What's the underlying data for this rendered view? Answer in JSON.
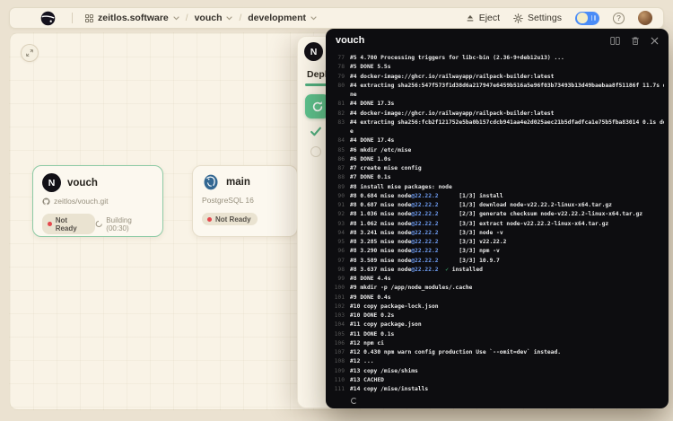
{
  "navbar": {
    "breadcrumb": {
      "workspace": "zeitlos.software",
      "project": "vouch",
      "environment": "development"
    },
    "eject_label": "Eject",
    "settings_label": "Settings",
    "help_icon": "?",
    "theme_toggle_on": true,
    "accent_toggle_color": "#4a8cf7",
    "icons": [
      "railway-logo",
      "workspace-icon",
      "chevron-down-icon",
      "eject-icon",
      "gear-icon",
      "help-icon",
      "avatar"
    ]
  },
  "canvas": {
    "cards": {
      "vouch": {
        "logo_letter": "N",
        "title": "vouch",
        "repo": "zeitlos/vouch.git",
        "status": "Not Ready",
        "status_dot_color": "#e5484d",
        "building": "Building (00:30)"
      },
      "main": {
        "title": "main",
        "subtitle": "PostgreSQL 16",
        "status": "Not Ready",
        "status_dot_color": "#e5484d"
      }
    }
  },
  "drawer": {
    "logo_letter": "N",
    "tab": "Deployments",
    "tab_accent": "#4fae7f",
    "icons": [
      "rotate-icon",
      "check-icon"
    ]
  },
  "log_panel": {
    "title": "vouch",
    "background": "#0d0d10",
    "icons": [
      "split-view-icon",
      "trash-icon",
      "close-icon"
    ],
    "lines": [
      {
        "n": "77",
        "s": [
          [
            "#5 4.700 Processing triggers for libc-bin (2.36-9+deb12u13) ...",
            "w"
          ]
        ]
      },
      {
        "n": "78",
        "s": [
          [
            "#5 DONE 5.5s",
            "w"
          ]
        ]
      },
      {
        "n": "79",
        "s": [
          [
            "#4 docker-image://ghcr.io/railwayapp/railpack-builder:latest",
            "w"
          ]
        ]
      },
      {
        "n": "80",
        "s": [
          [
            "#4 extracting sha256:547f573f1d38d6a217947e6459b516a5e96f03b73493b13d49baebaa8f51186f 11.7s do",
            "w"
          ]
        ]
      },
      {
        "n": "",
        "s": [
          [
            "ne",
            "w"
          ]
        ]
      },
      {
        "n": "81",
        "s": [
          [
            "#4 DONE 17.3s",
            "w"
          ]
        ]
      },
      {
        "n": "82",
        "s": [
          [
            "#4 docker-image://ghcr.io/railwayapp/railpack-builder:latest",
            "w"
          ]
        ]
      },
      {
        "n": "83",
        "s": [
          [
            "#4 extracting sha256:fcb2f121752e5ba0b157cdcb941aa4e2d025aec21b5dfadfca1e75b5fba83014 0.1s don",
            "w"
          ]
        ]
      },
      {
        "n": "",
        "s": [
          [
            "e",
            "w"
          ]
        ]
      },
      {
        "n": "84",
        "s": [
          [
            "#4 DONE 17.4s",
            "w"
          ]
        ]
      },
      {
        "n": "85",
        "s": [
          [
            "#6 mkdir /etc/mise",
            "w"
          ]
        ]
      },
      {
        "n": "86",
        "s": [
          [
            "#6 DONE 1.0s",
            "w"
          ]
        ]
      },
      {
        "n": "87",
        "s": [
          [
            "#7 create mise config",
            "w"
          ]
        ]
      },
      {
        "n": "88",
        "s": [
          [
            "#7 DONE 0.1s",
            "w"
          ]
        ]
      },
      {
        "n": "89",
        "s": [
          [
            "#8 install mise packages: node",
            "w"
          ]
        ]
      },
      {
        "n": "90",
        "s": [
          [
            "#8 0.684 mise node",
            "w"
          ],
          [
            "@22.22.2",
            "b"
          ],
          [
            "      [1/3] install",
            "w"
          ]
        ]
      },
      {
        "n": "91",
        "s": [
          [
            "#8 0.687 mise node",
            "w"
          ],
          [
            "@22.22.2",
            "b"
          ],
          [
            "      [1/3] download node-v22.22.2-linux-x64.tar.gz",
            "w"
          ]
        ]
      },
      {
        "n": "92",
        "s": [
          [
            "#8 1.036 mise node",
            "w"
          ],
          [
            "@22.22.2",
            "b"
          ],
          [
            "      [2/3] generate checksum node-v22.22.2-linux-x64.tar.gz",
            "w"
          ]
        ]
      },
      {
        "n": "93",
        "s": [
          [
            "#8 1.062 mise node",
            "w"
          ],
          [
            "@22.22.2",
            "b"
          ],
          [
            "      [3/3] extract node-v22.22.2-linux-x64.tar.gz",
            "w"
          ]
        ]
      },
      {
        "n": "94",
        "s": [
          [
            "#8 3.241 mise node",
            "w"
          ],
          [
            "@22.22.2",
            "b"
          ],
          [
            "      [3/3] node -v",
            "w"
          ]
        ]
      },
      {
        "n": "95",
        "s": [
          [
            "#8 3.285 mise node",
            "w"
          ],
          [
            "@22.22.2",
            "b"
          ],
          [
            "      [3/3] v22.22.2",
            "w"
          ]
        ]
      },
      {
        "n": "96",
        "s": [
          [
            "#8 3.290 mise node",
            "w"
          ],
          [
            "@22.22.2",
            "b"
          ],
          [
            "      [3/3] npm -v",
            "w"
          ]
        ]
      },
      {
        "n": "97",
        "s": [
          [
            "#8 3.589 mise node",
            "w"
          ],
          [
            "@22.22.2",
            "b"
          ],
          [
            "      [3/3] 10.9.7",
            "w"
          ]
        ]
      },
      {
        "n": "98",
        "s": [
          [
            "#8 3.637 mise node",
            "w"
          ],
          [
            "@22.22.2",
            "b"
          ],
          [
            "  ",
            "w"
          ],
          [
            "✓",
            "g"
          ],
          [
            " installed",
            "w"
          ]
        ]
      },
      {
        "n": "99",
        "s": [
          [
            "#8 DONE 4.4s",
            "w"
          ]
        ]
      },
      {
        "n": "100",
        "s": [
          [
            "#9 mkdir -p /app/node_modules/.cache",
            "w"
          ]
        ]
      },
      {
        "n": "101",
        "s": [
          [
            "#9 DONE 0.4s",
            "w"
          ]
        ]
      },
      {
        "n": "102",
        "s": [
          [
            "#10 copy package-lock.json",
            "w"
          ]
        ]
      },
      {
        "n": "103",
        "s": [
          [
            "#10 DONE 0.2s",
            "w"
          ]
        ]
      },
      {
        "n": "104",
        "s": [
          [
            "#11 copy package.json",
            "w"
          ]
        ]
      },
      {
        "n": "105",
        "s": [
          [
            "#11 DONE 0.1s",
            "w"
          ]
        ]
      },
      {
        "n": "106",
        "s": [
          [
            "#12 npm ci",
            "w"
          ]
        ]
      },
      {
        "n": "107",
        "s": [
          [
            "#12 0.430 npm warn config production Use `--omit=dev` instead.",
            "w"
          ]
        ]
      },
      {
        "n": "108",
        "s": [
          [
            "#12 ...",
            "w"
          ]
        ]
      },
      {
        "n": "109",
        "s": [
          [
            "#13 copy /mise/shims",
            "w"
          ]
        ]
      },
      {
        "n": "110",
        "s": [
          [
            "#13 CACHED",
            "w"
          ]
        ]
      },
      {
        "n": "111",
        "s": [
          [
            "#14 copy /mise/installs",
            "w"
          ]
        ]
      }
    ]
  }
}
